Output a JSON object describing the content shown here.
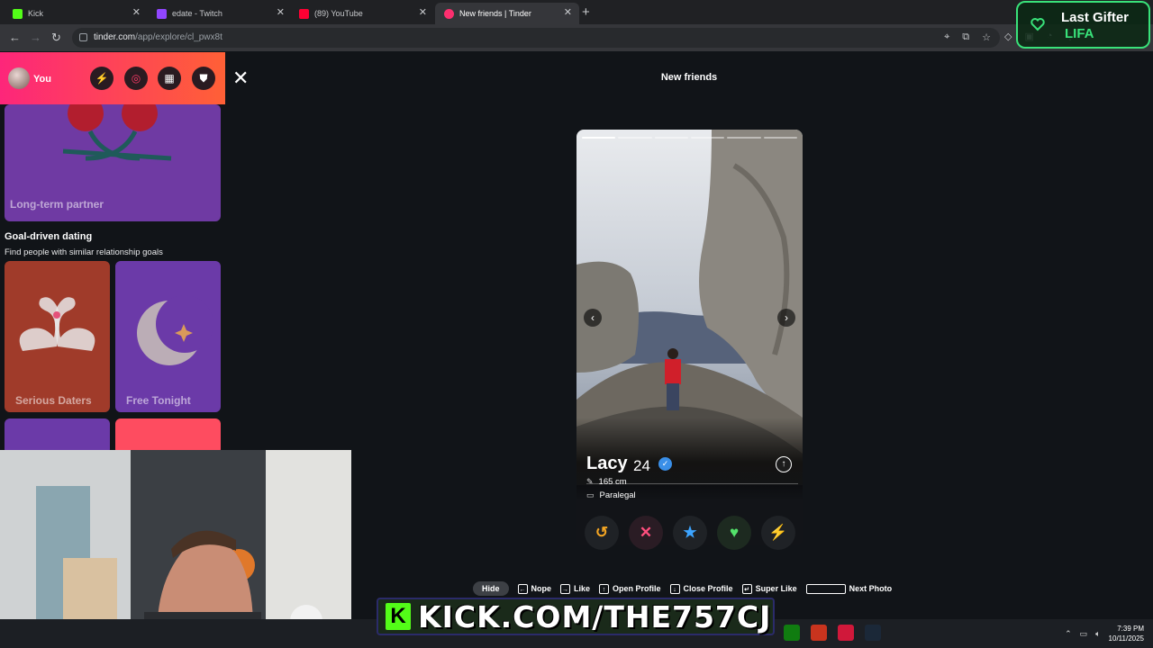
{
  "browser": {
    "tabs": [
      {
        "title": "Kick",
        "favicon_color": "#53fc18"
      },
      {
        "title": "edate - Twitch",
        "favicon_color": "#9146ff"
      },
      {
        "title": "(89) YouTube",
        "favicon_color": "#ff0033"
      },
      {
        "title": "New friends | Tinder",
        "favicon_color": "#fd2f6f"
      }
    ],
    "url_host": "tinder.com",
    "url_path": "/app/explore/cl_pwx8t"
  },
  "overlay": {
    "gifter_title": "Last Gifter",
    "gifter_name": "LIFA"
  },
  "sidebar": {
    "user_label": "You",
    "top_card_label": "Long-term partner",
    "section_title": "Goal-driven dating",
    "section_subtitle": "Find people with similar relationship goals",
    "cards": [
      {
        "label": "Serious Daters",
        "color": "#a03b2a"
      },
      {
        "label": "Free Tonight",
        "color": "#6b3aa8"
      }
    ]
  },
  "main": {
    "title": "New friends",
    "profile": {
      "name": "Lacy",
      "age": "24",
      "height": "165 cm",
      "job": "Paralegal",
      "photo_count": 6,
      "current_photo": 1
    },
    "shortcuts": {
      "hide": "Hide",
      "nope": "Nope",
      "like": "Like",
      "open_profile": "Open Profile",
      "close_profile": "Close Profile",
      "super_like": "Super Like",
      "next_photo": "Next Photo"
    }
  },
  "stream": {
    "banner": "KICK.COM/THE757CJ"
  },
  "taskbar": {
    "time": "7:39 PM",
    "date": "10/11/2025"
  },
  "colors": {
    "tinder_gradient_start": "#fd267a",
    "tinder_gradient_end": "#ff6036",
    "kick_green": "#53fc18"
  }
}
